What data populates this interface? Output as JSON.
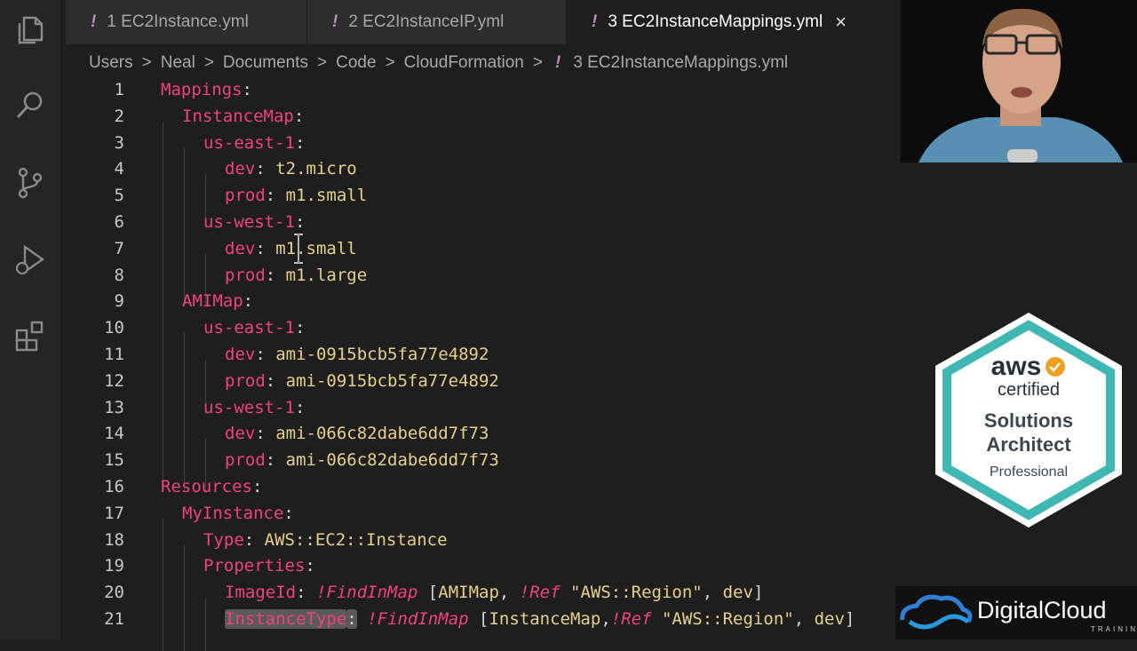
{
  "tabs": [
    {
      "label": "1 EC2Instance.yml",
      "active": false
    },
    {
      "label": "2 EC2InstanceIP.yml",
      "active": false
    },
    {
      "label": "3 EC2InstanceMappings.yml",
      "active": true
    }
  ],
  "tab_close": "×",
  "tab_modified_glyph": "!",
  "breadcrumb": {
    "items": [
      "Users",
      "Neal",
      "Documents",
      "Code",
      "CloudFormation"
    ],
    "separator": ">",
    "file_glyph": "!",
    "file": "3 EC2InstanceMappings.yml"
  },
  "editor": {
    "lines": [
      {
        "n": "1",
        "indent": 0,
        "tokens": [
          {
            "t": "k",
            "s": "Mappings"
          },
          {
            "t": "p",
            "s": ":"
          }
        ]
      },
      {
        "n": "2",
        "indent": 1,
        "tokens": [
          {
            "t": "k",
            "s": "InstanceMap"
          },
          {
            "t": "p",
            "s": ":"
          }
        ]
      },
      {
        "n": "3",
        "indent": 2,
        "tokens": [
          {
            "t": "k",
            "s": "us-east-1"
          },
          {
            "t": "p",
            "s": ":"
          }
        ]
      },
      {
        "n": "4",
        "indent": 3,
        "tokens": [
          {
            "t": "k",
            "s": "dev"
          },
          {
            "t": "p",
            "s": ": "
          },
          {
            "t": "v",
            "s": "t2.micro"
          }
        ]
      },
      {
        "n": "5",
        "indent": 3,
        "tokens": [
          {
            "t": "k",
            "s": "prod"
          },
          {
            "t": "p",
            "s": ": "
          },
          {
            "t": "v",
            "s": "m1.small"
          }
        ]
      },
      {
        "n": "6",
        "indent": 2,
        "tokens": [
          {
            "t": "k",
            "s": "us-west-1"
          },
          {
            "t": "p",
            "s": ":"
          }
        ]
      },
      {
        "n": "7",
        "indent": 3,
        "tokens": [
          {
            "t": "k",
            "s": "dev"
          },
          {
            "t": "p",
            "s": ": "
          },
          {
            "t": "v",
            "s": "m1.small"
          }
        ]
      },
      {
        "n": "8",
        "indent": 3,
        "tokens": [
          {
            "t": "k",
            "s": "prod"
          },
          {
            "t": "p",
            "s": ": "
          },
          {
            "t": "v",
            "s": "m1.large"
          }
        ]
      },
      {
        "n": "9",
        "indent": 1,
        "tokens": [
          {
            "t": "k",
            "s": "AMIMap"
          },
          {
            "t": "p",
            "s": ":"
          }
        ]
      },
      {
        "n": "10",
        "indent": 2,
        "tokens": [
          {
            "t": "k",
            "s": "us-east-1"
          },
          {
            "t": "p",
            "s": ":"
          }
        ]
      },
      {
        "n": "11",
        "indent": 3,
        "tokens": [
          {
            "t": "k",
            "s": "dev"
          },
          {
            "t": "p",
            "s": ": "
          },
          {
            "t": "v",
            "s": "ami-0915bcb5fa77e4892"
          }
        ]
      },
      {
        "n": "12",
        "indent": 3,
        "tokens": [
          {
            "t": "k",
            "s": "prod"
          },
          {
            "t": "p",
            "s": ": "
          },
          {
            "t": "v",
            "s": "ami-0915bcb5fa77e4892"
          }
        ]
      },
      {
        "n": "13",
        "indent": 2,
        "tokens": [
          {
            "t": "k",
            "s": "us-west-1"
          },
          {
            "t": "p",
            "s": ":"
          }
        ]
      },
      {
        "n": "14",
        "indent": 3,
        "tokens": [
          {
            "t": "k",
            "s": "dev"
          },
          {
            "t": "p",
            "s": ": "
          },
          {
            "t": "v",
            "s": "ami-066c82dabe6dd7f73"
          }
        ]
      },
      {
        "n": "15",
        "indent": 3,
        "tokens": [
          {
            "t": "k",
            "s": "prod"
          },
          {
            "t": "p",
            "s": ": "
          },
          {
            "t": "v",
            "s": "ami-066c82dabe6dd7f73"
          }
        ]
      },
      {
        "n": "16",
        "indent": 0,
        "tokens": [
          {
            "t": "k",
            "s": "Resources"
          },
          {
            "t": "p",
            "s": ":"
          }
        ]
      },
      {
        "n": "17",
        "indent": 1,
        "tokens": [
          {
            "t": "k",
            "s": "MyInstance"
          },
          {
            "t": "p",
            "s": ":"
          }
        ]
      },
      {
        "n": "18",
        "indent": 2,
        "tokens": [
          {
            "t": "k",
            "s": "Type"
          },
          {
            "t": "p",
            "s": ": "
          },
          {
            "t": "v",
            "s": "AWS::EC2::Instance"
          }
        ]
      },
      {
        "n": "19",
        "indent": 2,
        "tokens": [
          {
            "t": "k",
            "s": "Properties"
          },
          {
            "t": "p",
            "s": ":"
          }
        ]
      },
      {
        "n": "20",
        "indent": 3,
        "tokens": [
          {
            "t": "k",
            "s": "ImageId"
          },
          {
            "t": "p",
            "s": ": "
          },
          {
            "t": "fn",
            "s": "!FindInMap"
          },
          {
            "t": "p",
            "s": " ["
          },
          {
            "t": "v",
            "s": "AMIMap"
          },
          {
            "t": "p",
            "s": ", "
          },
          {
            "t": "fn",
            "s": "!Ref"
          },
          {
            "t": "p",
            "s": " "
          },
          {
            "t": "str",
            "s": "\"AWS::Region\""
          },
          {
            "t": "p",
            "s": ", "
          },
          {
            "t": "v",
            "s": "dev"
          },
          {
            "t": "p",
            "s": "]"
          }
        ]
      },
      {
        "n": "21",
        "indent": 3,
        "tokens": [
          {
            "t": "k hl",
            "s": "InstanceType"
          },
          {
            "t": "p hl",
            "s": ":"
          },
          {
            "t": "p",
            "s": " "
          },
          {
            "t": "fn",
            "s": "!FindInMap"
          },
          {
            "t": "p",
            "s": " ["
          },
          {
            "t": "v",
            "s": "InstanceMap"
          },
          {
            "t": "p",
            "s": ","
          },
          {
            "t": "fn",
            "s": "!Ref"
          },
          {
            "t": "p",
            "s": " "
          },
          {
            "t": "str",
            "s": "\"AWS::Region\""
          },
          {
            "t": "p",
            "s": ", "
          },
          {
            "t": "v",
            "s": "dev"
          },
          {
            "t": "p",
            "s": "]"
          }
        ]
      }
    ]
  },
  "badge": {
    "brand": "aws",
    "line1": "certified",
    "line2": "Solutions",
    "line3": "Architect",
    "line4": "Professional",
    "ring_color": "#3fb8b4",
    "check_color": "#f0a020"
  },
  "logo": {
    "name": "DigitalCloud",
    "sub": "TRAINING"
  },
  "colors": {
    "key": "#f0427b",
    "value": "#e6d08a",
    "bang": "#c586c0"
  }
}
